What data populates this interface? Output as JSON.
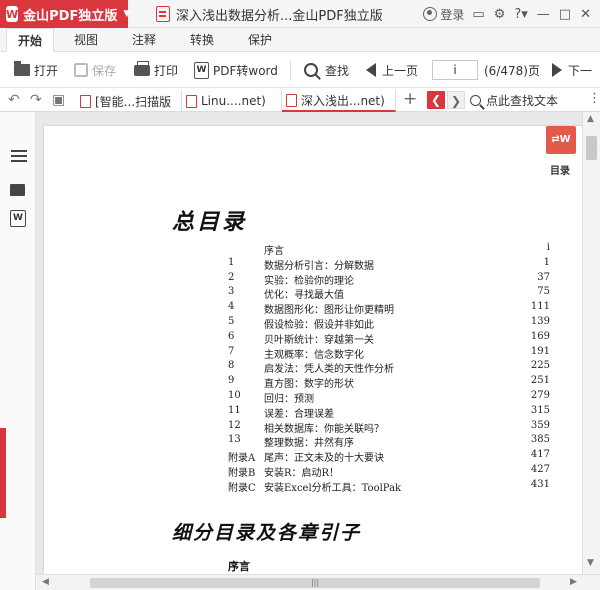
{
  "app": {
    "name": "金山PDF独立版",
    "logo": "W",
    "accent": "#d9363e"
  },
  "document_title": "深入浅出数据分析...金山PDF独立版",
  "titlebar": {
    "login_label": "登录",
    "icons": [
      "user-icon",
      "message-icon",
      "settings-icon",
      "help-icon",
      "minimize-icon",
      "maximize-icon",
      "close-icon"
    ]
  },
  "menu_tabs": [
    {
      "label": "开始",
      "active": true
    },
    {
      "label": "视图",
      "active": false
    },
    {
      "label": "注释",
      "active": false
    },
    {
      "label": "转换",
      "active": false
    },
    {
      "label": "保护",
      "active": false
    }
  ],
  "toolbar": {
    "open_label": "打开",
    "save_label": "保存",
    "print_label": "打印",
    "pdf2word_label": "PDF转word",
    "find_label": "查找",
    "prev_label": "上一页",
    "page_input": "i",
    "page_count": "(6/478)页",
    "next_label": "下一"
  },
  "doc_tabs": [
    {
      "label": "[智能...扫描版",
      "active": false
    },
    {
      "label": "Linu....net)",
      "active": false
    },
    {
      "label": "深入浅出...net)",
      "active": true
    }
  ],
  "find_text_label": "点此查找文本",
  "right_sidebar": {
    "toc_label": "目录"
  },
  "page_content": {
    "toc_heading": "总目录",
    "toc": [
      {
        "num": "",
        "title": "序言",
        "page": "i"
      },
      {
        "num": "1",
        "title": "数据分析引言：分解数据",
        "page": "1"
      },
      {
        "num": "2",
        "title": "实验：检验你的理论",
        "page": "37"
      },
      {
        "num": "3",
        "title": "优化：寻找最大值",
        "page": "75"
      },
      {
        "num": "4",
        "title": "数据图形化：图形让你更精明",
        "page": "111"
      },
      {
        "num": "5",
        "title": "假设检验：假设并非如此",
        "page": "139"
      },
      {
        "num": "6",
        "title": "贝叶斯统计：穿越第一关",
        "page": "169"
      },
      {
        "num": "7",
        "title": "主观概率：信念数字化",
        "page": "191"
      },
      {
        "num": "8",
        "title": "启发法：凭人类的天性作分析",
        "page": "225"
      },
      {
        "num": "9",
        "title": "直方图：数字的形状",
        "page": "251"
      },
      {
        "num": "10",
        "title": "回归：预测",
        "page": "279"
      },
      {
        "num": "11",
        "title": "误差：合理误差",
        "page": "315"
      },
      {
        "num": "12",
        "title": "相关数据库：你能关联吗？",
        "page": "359"
      },
      {
        "num": "13",
        "title": "整理数据：井然有序",
        "page": "385"
      },
      {
        "num": "附录A",
        "title": "尾声：正文未及的十大要诀",
        "page": "417"
      },
      {
        "num": "附录B",
        "title": "安装R：启动R！",
        "page": "427"
      },
      {
        "num": "附录C",
        "title": "安装Excel分析工具：ToolPak",
        "page": "431"
      }
    ],
    "sub_heading": "细分目录及各章引子",
    "preface_heading": "序言"
  }
}
